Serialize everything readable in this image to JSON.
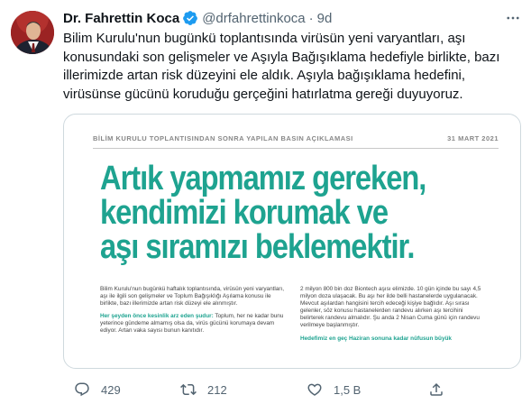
{
  "author": {
    "name": "Dr. Fahrettin Koca",
    "handle": "@drfahrettinkoca",
    "separator": "·",
    "time": "9d"
  },
  "tweet": {
    "text": "Bilim Kurulu'nun bugünkü toplantısında virüsün yeni varyantları, aşı konusundaki son gelişmeler ve Aşıyla Bağışıklama hedefiyle birlikte, bazı illerimizde artan risk düzeyini ele aldık. Aşıyla bağışıklama hedefini, virüsünse gücünü koruduğu gerçeğini hatırlatma gereği duyuyoruz."
  },
  "media": {
    "header_title": "BİLİM KURULU TOPLANTISINDAN SONRA YAPILAN BASIN AÇIKLAMASI",
    "header_date": "31 MART 2021",
    "headline_lines": [
      "Artık yapmamız gereken,",
      "kendimizi korumak ve",
      "aşı sıramızı beklemektir."
    ],
    "left_p1": "Bilim Kurulu'nun bugünkü haftalık toplantısında, virüsün yeni varyantları, aşı ile ilgili son gelişmeler ve Toplum Bağışıklığı Aşılama konusu ile birlikte, bazı illerimizde artan risk düzeyi ele alınmıştır.",
    "left_p2_highlight": "Her şeyden önce kesinlik arz eden şudur:",
    "left_p2_rest": " Toplum, her ne kadar bunu yeterince gündeme almamış olsa da, virüs gücünü korumaya devam ediyor. Artan vaka sayısı bunun kanıtıdır.",
    "right_p1": "2 milyon 800 bin doz Biontech aşısı elimizde. 10 gün içinde bu sayı 4,5 milyon doza ulaşacak. Bu aşı her ilde belli hastanelerde uygulanacak. Mevcut aşılardan hangisini tercih edeceği kişiye bağlıdır. Aşı sırası gelenler, söz konusu hastanelerden randevu alırken aşı tercihini belirterek randevu almalıdır. Şu anda 2 Nisan Cuma günü için randevu verilmeye başlanmıştır.",
    "right_p2_highlight": "Hedefimiz en geç Haziran sonuna kadar nüfusun büyük"
  },
  "actions": {
    "reply_count": "429",
    "retweet_count": "212",
    "like_count": "1,5 B"
  },
  "colors": {
    "accent_green": "#1ea390",
    "verified_blue": "#1d9bf0",
    "muted": "#536471"
  }
}
